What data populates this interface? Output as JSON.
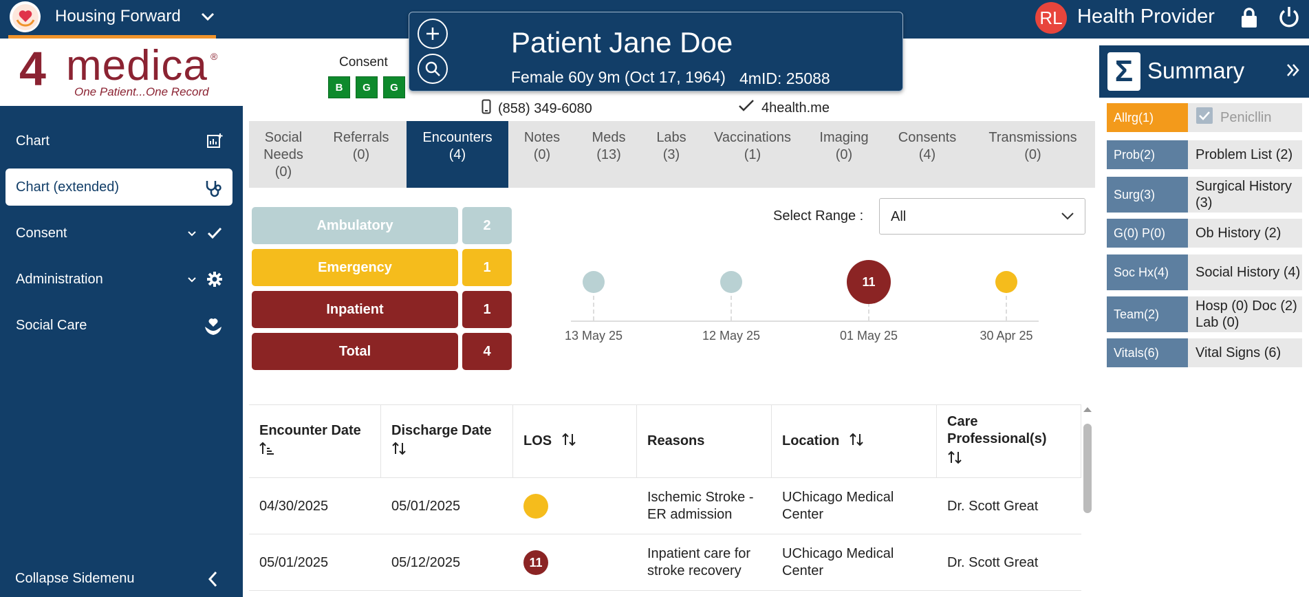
{
  "topbar": {
    "org_name": "Housing Forward",
    "user_initials": "RL",
    "user_role": "Health Provider"
  },
  "brand": {
    "four": "4",
    "name": "medica",
    "reg": "®",
    "tagline": "One Patient...One Record"
  },
  "sidebar": {
    "items": [
      {
        "label": "Chart",
        "icon": "chart-add-icon"
      },
      {
        "label": "Chart (extended)",
        "icon": "stethoscope-icon"
      },
      {
        "label": "Consent",
        "icon": "check-icon"
      },
      {
        "label": "Administration",
        "icon": "gear-icon"
      },
      {
        "label": "Social Care",
        "icon": "hands-heart-icon"
      }
    ],
    "collapse_label": "Collapse Sidemenu"
  },
  "header": {
    "consent_label": "Consent",
    "consent_boxes": [
      "B",
      "G",
      "G"
    ],
    "phone": "(858) 349-6080",
    "site": "4health.me"
  },
  "patient": {
    "name": "Patient Jane Doe",
    "demographics": "Female 60y 9m (Oct 17, 1964)",
    "id": "4mID: 25088"
  },
  "tabs": [
    {
      "line1": "Social",
      "line2": "Needs",
      "line3": "(0)"
    },
    {
      "line1": "Referrals",
      "line2": "(0)"
    },
    {
      "line1": "Encounters",
      "line2": "(4)"
    },
    {
      "line1": "Notes",
      "line2": "(0)"
    },
    {
      "line1": "Meds",
      "line2": "(13)"
    },
    {
      "line1": "Labs",
      "line2": "(3)"
    },
    {
      "line1": "Vaccinations",
      "line2": "(1)"
    },
    {
      "line1": "Imaging",
      "line2": "(0)"
    },
    {
      "line1": "Consents",
      "line2": "(4)"
    },
    {
      "line1": "Transmissions",
      "line2": "(0)"
    }
  ],
  "encounter_summary": [
    {
      "label": "Ambulatory",
      "count": "2",
      "color": "#b9d1d3"
    },
    {
      "label": "Emergency",
      "count": "1",
      "color": "#f5bc1c"
    },
    {
      "label": "Inpatient",
      "count": "1",
      "color": "#8b2424"
    },
    {
      "label": "Total",
      "count": "4",
      "color": "#8b2424"
    }
  ],
  "range": {
    "label": "Select Range :",
    "value": "All"
  },
  "timeline": [
    {
      "date": "13 May 25",
      "type": "Ambulatory",
      "value": "",
      "color": "#b9d1d3"
    },
    {
      "date": "12 May 25",
      "type": "Ambulatory",
      "value": "",
      "color": "#b9d1d3"
    },
    {
      "date": "01 May 25",
      "type": "Inpatient",
      "value": "11",
      "color": "#8b2424"
    },
    {
      "date": "30 Apr 25",
      "type": "Emergency",
      "value": "",
      "color": "#f5bc1c"
    }
  ],
  "table": {
    "headers": [
      "Encounter Date",
      "Discharge Date",
      "LOS",
      "Reasons",
      "Location",
      "Care Professional(s)"
    ],
    "rows": [
      {
        "encounter_date": "04/30/2025",
        "discharge_date": "05/01/2025",
        "los": "",
        "los_color": "#f5bc1c",
        "reasons": "Ischemic Stroke - ER admission",
        "location": "UChicago Medical Center",
        "professional": "Dr. Scott Great"
      },
      {
        "encounter_date": "05/01/2025",
        "discharge_date": "05/12/2025",
        "los": "11",
        "los_color": "#8b2424",
        "reasons": "Inpatient care for stroke recovery",
        "location": "UChicago Medical Center",
        "professional": "Dr. Scott Great"
      }
    ]
  },
  "summary": {
    "title": "Summary",
    "rows": [
      {
        "tag": "Allrg(1)",
        "value": "Penicllin",
        "tag_color": "#f39a1b"
      },
      {
        "tag": "Prob(2)",
        "value": "Problem List (2)",
        "tag_color": "#5d7fa0"
      },
      {
        "tag": "Surg(3)",
        "value": "Surgical History (3)",
        "tag_color": "#5d7fa0"
      },
      {
        "tag": "G(0) P(0)",
        "value": "Ob History (2)",
        "tag_color": "#5d7fa0"
      },
      {
        "tag": "Soc Hx(4)",
        "value": "Social History (4)",
        "tag_color": "#5d7fa0"
      },
      {
        "tag": "Team(2)",
        "value": "Hosp (0) Doc (2) Lab (0)",
        "tag_color": "#5d7fa0"
      },
      {
        "tag": "Vitals(6)",
        "value": "Vital Signs (6)",
        "tag_color": "#5d7fa0"
      }
    ]
  }
}
